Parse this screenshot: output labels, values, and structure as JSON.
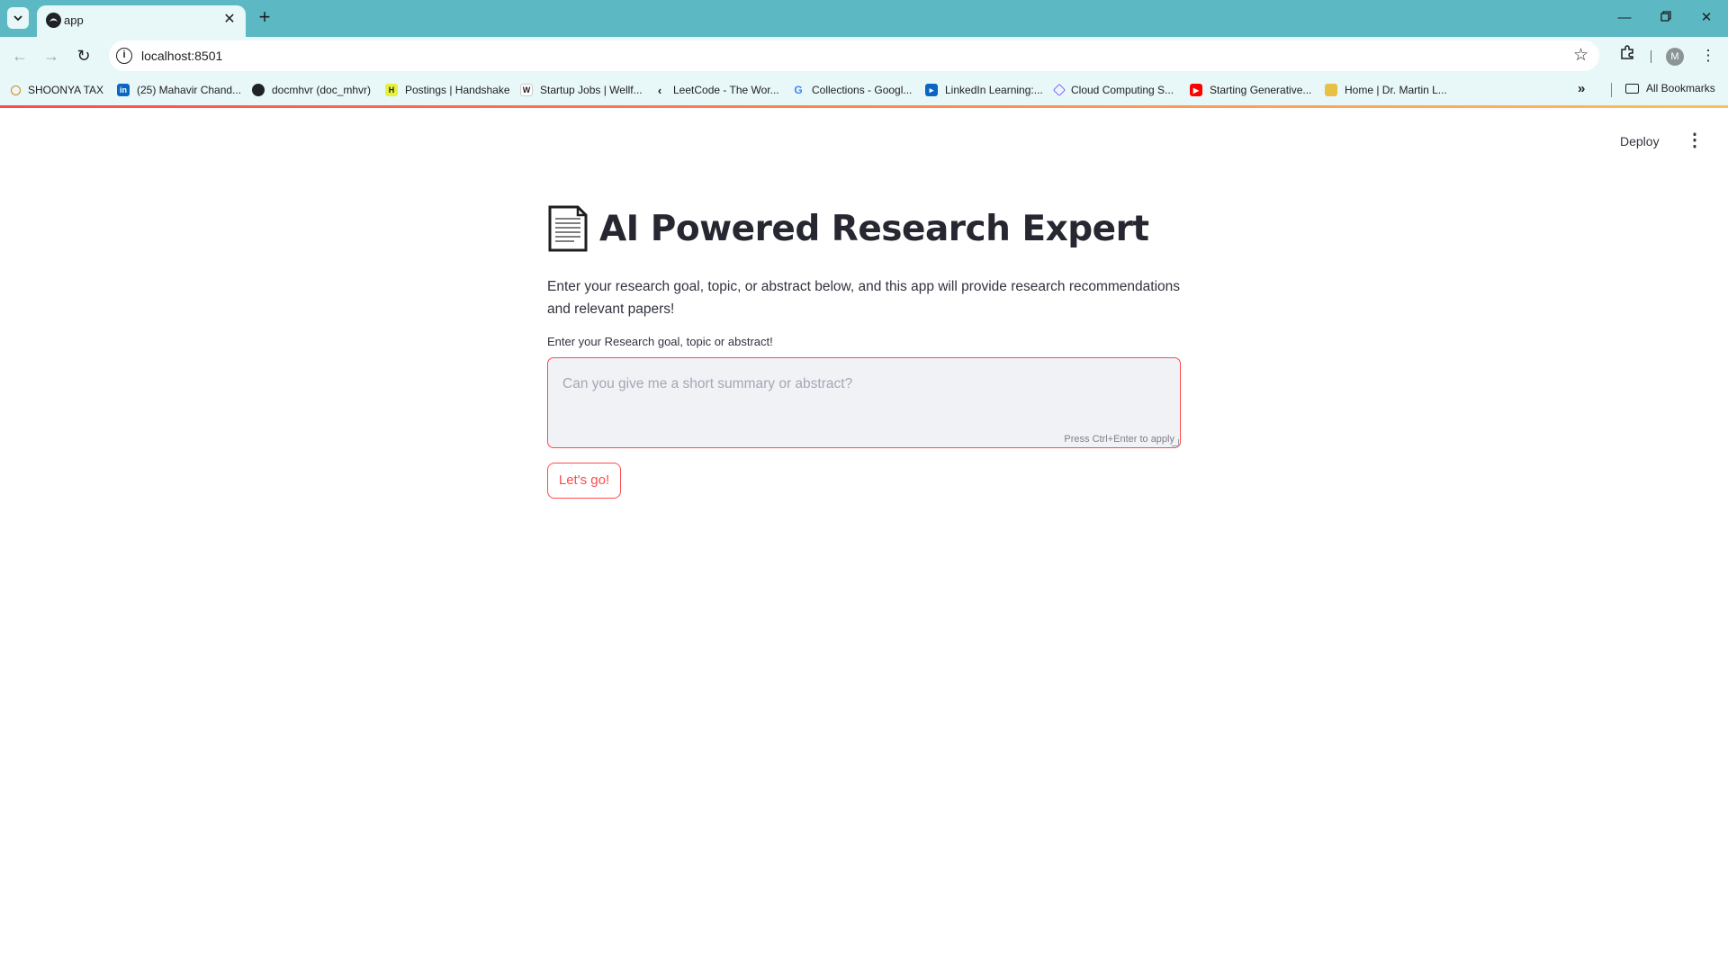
{
  "browser": {
    "tab": {
      "title": "app",
      "favicon": "streamlit-icon"
    },
    "url": "localhost:8501",
    "bookmarks": [
      {
        "label": "SHOONYA TAX",
        "icon": "search-icon"
      },
      {
        "label": "(25) Mahavir Chand...",
        "icon": "linkedin-icon"
      },
      {
        "label": "docmhvr (doc_mhvr)",
        "icon": "github-icon"
      },
      {
        "label": "Postings | Handshake",
        "icon": "handshake-icon"
      },
      {
        "label": "Startup Jobs | Wellf...",
        "icon": "wellfound-icon"
      },
      {
        "label": "LeetCode - The Wor...",
        "icon": "leetcode-icon"
      },
      {
        "label": "Collections - Googl...",
        "icon": "google-icon"
      },
      {
        "label": "LinkedIn Learning:...",
        "icon": "linkedin-learning-icon"
      },
      {
        "label": "Cloud Computing S...",
        "icon": "cube-icon"
      },
      {
        "label": "Starting Generative...",
        "icon": "youtube-icon"
      },
      {
        "label": "Home | Dr. Martin L...",
        "icon": "bookmark-icon"
      }
    ],
    "all_bookmarks": "All Bookmarks",
    "profile_initial": "M"
  },
  "app": {
    "header": {
      "deploy_label": "Deploy"
    },
    "title": "AI Powered Research Expert",
    "description": "Enter your research goal, topic, or abstract below, and this app will provide research recommendations and relevant papers!",
    "input": {
      "label": "Enter your Research goal, topic or abstract!",
      "placeholder": "Can you give me a short summary or abstract?",
      "value": "",
      "hint": "Press Ctrl+Enter to apply"
    },
    "submit_label": "Let's go!"
  },
  "colors": {
    "tabstrip": "#5cb8c2",
    "toolbar": "#e8f7f8",
    "accent": "#ff4b4b",
    "text": "#31333f"
  }
}
